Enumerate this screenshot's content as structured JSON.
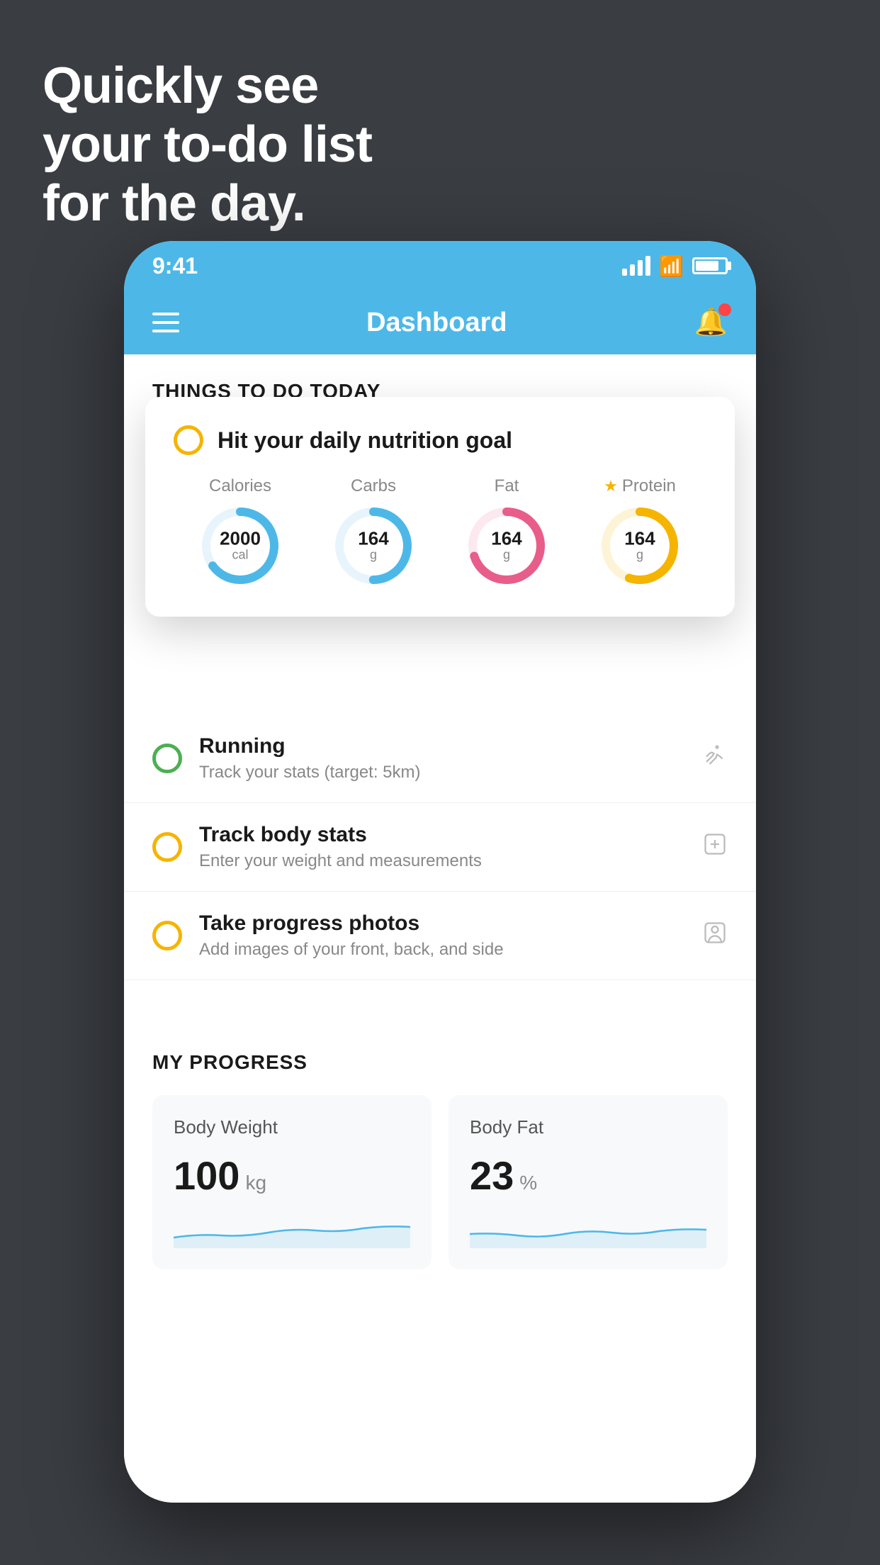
{
  "hero": {
    "line1": "Quickly see",
    "line2": "your to-do list",
    "line3": "for the day."
  },
  "statusBar": {
    "time": "9:41"
  },
  "header": {
    "title": "Dashboard"
  },
  "thingsToDoSection": {
    "heading": "THINGS TO DO TODAY"
  },
  "nutritionCard": {
    "title": "Hit your daily nutrition goal",
    "items": [
      {
        "label": "Calories",
        "value": "2000",
        "unit": "cal",
        "color": "#4db8e8",
        "percent": 65,
        "starred": false
      },
      {
        "label": "Carbs",
        "value": "164",
        "unit": "g",
        "color": "#4db8e8",
        "percent": 50,
        "starred": false
      },
      {
        "label": "Fat",
        "value": "164",
        "unit": "g",
        "color": "#e85d8a",
        "percent": 70,
        "starred": false
      },
      {
        "label": "Protein",
        "value": "164",
        "unit": "g",
        "color": "#f5b400",
        "percent": 55,
        "starred": true
      }
    ]
  },
  "todoItems": [
    {
      "title": "Running",
      "subtitle": "Track your stats (target: 5km)",
      "radioColor": "green",
      "icon": "👟"
    },
    {
      "title": "Track body stats",
      "subtitle": "Enter your weight and measurements",
      "radioColor": "yellow",
      "icon": "⚖️"
    },
    {
      "title": "Take progress photos",
      "subtitle": "Add images of your front, back, and side",
      "radioColor": "yellow",
      "icon": "👤"
    }
  ],
  "progressSection": {
    "heading": "MY PROGRESS",
    "cards": [
      {
        "title": "Body Weight",
        "value": "100",
        "unit": "kg"
      },
      {
        "title": "Body Fat",
        "value": "23",
        "unit": "%"
      }
    ]
  }
}
